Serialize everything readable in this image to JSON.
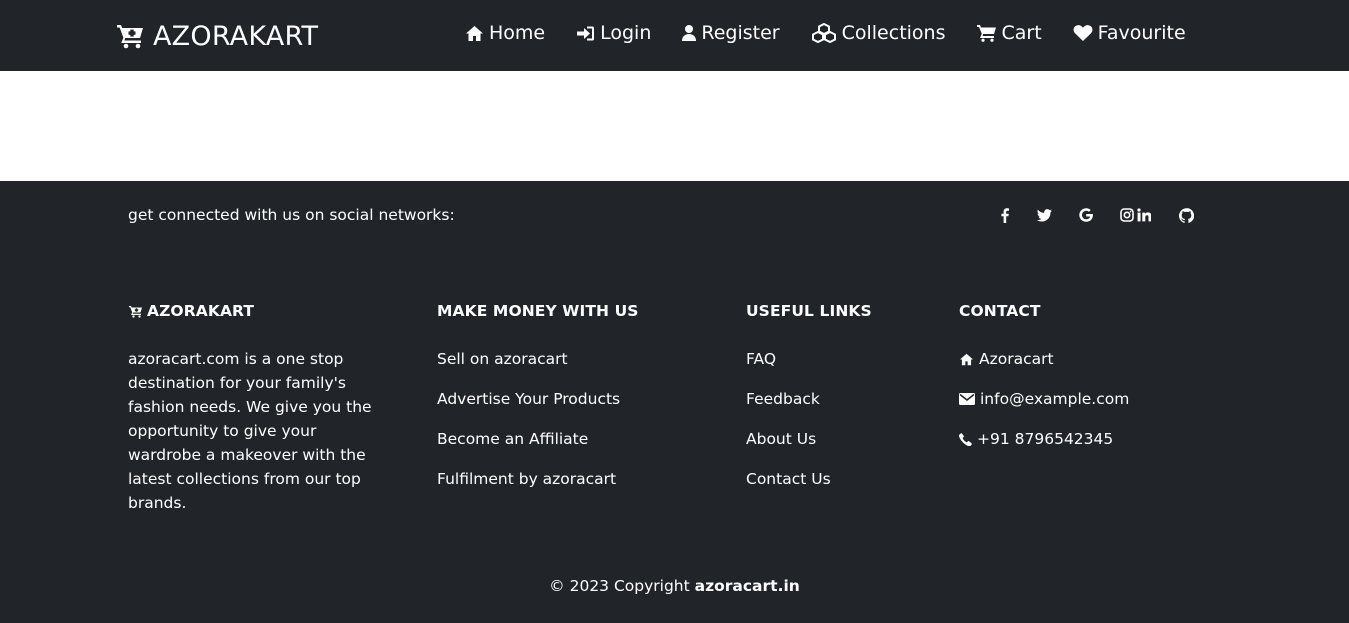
{
  "navbar": {
    "brand": {
      "icon": "cart-plus-icon",
      "label": "AZORAKART"
    },
    "items": [
      {
        "icon": "home-icon",
        "label": "Home"
      },
      {
        "icon": "sign-in-icon",
        "label": "Login"
      },
      {
        "icon": "user-icon",
        "label": "Register"
      },
      {
        "icon": "cubes-icon",
        "label": "Collections"
      },
      {
        "icon": "cart-icon",
        "label": "Cart"
      },
      {
        "icon": "heart-icon",
        "label": "Favourite"
      }
    ]
  },
  "footer": {
    "social_text": "get connected with us on social networks:",
    "social_icons": [
      "facebook-icon",
      "twitter-icon",
      "google-icon",
      "instagram-icon",
      "linkedin-icon",
      "github-icon"
    ],
    "columns": {
      "about": {
        "title": "AZORAKART",
        "text": "azoracart.com is a one stop destination for your family's fashion needs. We give you the opportunity to give your wardrobe a makeover with the latest collections from our top brands."
      },
      "money": {
        "title": "MAKE MONEY WITH US",
        "links": [
          "Sell on azoracart",
          "Advertise Your Products",
          "Become an Affiliate",
          "Fulfilment by azoracart"
        ]
      },
      "useful": {
        "title": "USEFUL LINKS",
        "links": [
          "FAQ",
          "Feedback",
          "About Us",
          "Contact Us"
        ]
      },
      "contact": {
        "title": "CONTACT",
        "items": [
          {
            "icon": "home-icon",
            "text": "Azoracart"
          },
          {
            "icon": "envelope-icon",
            "text": "info@example.com"
          },
          {
            "icon": "phone-icon",
            "text": "+91 8796542345"
          }
        ]
      }
    },
    "copyright": {
      "prefix": "© 2023 Copyright ",
      "site": "azoracart.in"
    }
  },
  "colors": {
    "dark": "#212529",
    "text": "#ffffff",
    "page": "#ffffff"
  }
}
